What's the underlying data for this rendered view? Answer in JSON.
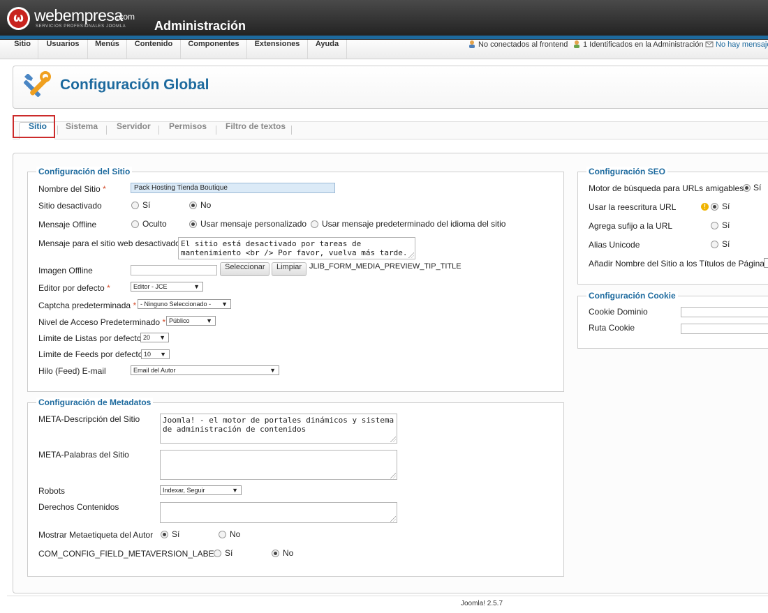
{
  "header": {
    "brand": "webempresa",
    "brand_suffix": ".com",
    "brand_tagline": "SERVICIOS PROFESIONALES JOOMLA",
    "title": "Administración"
  },
  "menu": {
    "items": [
      "Sitio",
      "Usuarios",
      "Menús",
      "Contenido",
      "Componentes",
      "Extensiones",
      "Ayuda"
    ],
    "status": {
      "frontend": "No conectados al frontend",
      "admin": "1 Identificados en la Administración",
      "messages": "No hay mensajes"
    }
  },
  "page": {
    "title": "Configuración Global",
    "icon": "tools-icon"
  },
  "tabs": [
    "Sitio",
    "Sistema",
    "Servidor",
    "Permisos",
    "Filtro de textos"
  ],
  "site": {
    "legend": "Configuración del Sitio",
    "site_name_label": "Nombre del Sitio",
    "site_name_value": "Pack Hosting Tienda Boutique",
    "offline_label": "Sitio desactivado",
    "offline_yes": "Sí",
    "offline_no": "No",
    "offline_msg_label": "Mensaje Offline",
    "offline_msg_opt1": "Oculto",
    "offline_msg_opt2": "Usar mensaje personalizado",
    "offline_msg_opt3": "Usar mensaje predeterminado del idioma del sitio",
    "offline_text_label": "Mensaje para el sitio web desactivado",
    "offline_text_value": "El sitio está desactivado por tareas de\nmantenimiento <br /> Por favor, vuelva más tarde.",
    "offline_image_label": "Imagen Offline",
    "select_button": "Seleccionar",
    "clear_button": "Limpiar",
    "preview_tip": "JLIB_FORM_MEDIA_PREVIEW_TIP_TITLE",
    "editor_label": "Editor por defecto",
    "editor_value": "Editor - JCE",
    "captcha_label": "Captcha predeterminada",
    "captcha_value": "- Ninguno Seleccionado -",
    "access_label": "Nivel de Acceso Predeterminado",
    "access_value": "Público",
    "list_limit_label": "Límite de Listas por defecto",
    "list_limit_value": "20",
    "feed_limit_label": "Límite de Feeds por defecto",
    "feed_limit_value": "10",
    "feed_email_label": "Hilo (Feed) E-mail",
    "feed_email_value": "Email del Autor"
  },
  "metadata": {
    "legend": "Configuración de Metadatos",
    "desc_label": "META-Descripción del Sitio",
    "desc_value": "Joomla! - el motor de portales dinámicos y sistema\nde administración de contenidos",
    "keywords_label": "META-Palabras del Sitio",
    "keywords_value": "",
    "robots_label": "Robots",
    "robots_value": "Indexar, Seguir",
    "rights_label": "Derechos Contenidos",
    "rights_value": "",
    "author_label": "Mostrar Metaetiqueta del Autor",
    "author_yes": "Sí",
    "author_no": "No",
    "version_label": "COM_CONFIG_FIELD_METAVERSION_LABEL",
    "version_yes": "Sí",
    "version_no": "No"
  },
  "seo": {
    "legend": "Configuración SEO",
    "sef_label": "Motor de búsqueda para URLs amigables",
    "sef_yes": "Sí",
    "rewrite_label": "Usar la reescritura URL",
    "rewrite_yes": "Sí",
    "suffix_label": "Agrega sufijo a la URL",
    "suffix_yes": "Sí",
    "unicode_label": "Alias Unicode",
    "unicode_yes": "Sí",
    "sitename_label": "Añadir Nombre del Sitio a los Títulos de Páginas"
  },
  "cookie": {
    "legend": "Configuración Cookie",
    "domain_label": "Cookie Dominio",
    "path_label": "Ruta Cookie"
  },
  "footer": {
    "version": "Joomla! 2.5.7"
  }
}
